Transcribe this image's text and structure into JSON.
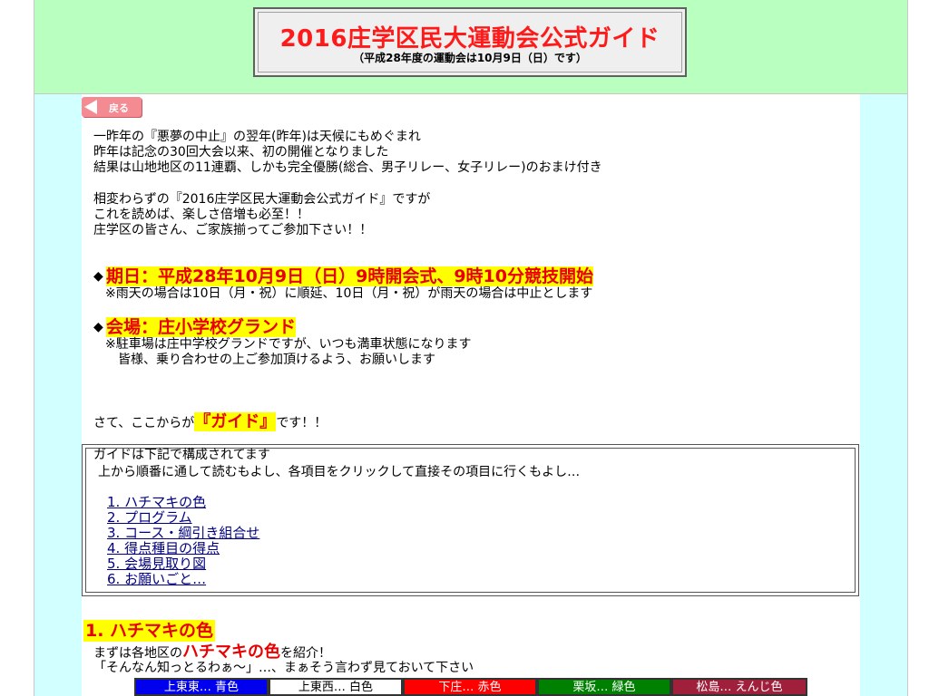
{
  "header": {
    "title": "2016庄学区民大運動会公式ガイド",
    "subtitle": "（平成28年度の運動会は10月9日（日）です）"
  },
  "back_button": {
    "label": "戻る"
  },
  "intro": [
    "一昨年の『悪夢の中止』の翌年(昨年)は天候にもめぐまれ",
    "昨年は記念の30回大会以来、初の開催となりました",
    "結果は山地地区の11連覇、しかも完全優勝(総合、男子リレー、女子リレー)のおまけ付き",
    "相変わらずの『2016庄学区民大運動会公式ガイド』ですが",
    "これを読めば、楽しさ倍増も必至！！",
    "庄学区の皆さん、ご家族揃ってご参加下さい！！"
  ],
  "date": {
    "bullet": "◆",
    "headline": "期日：平成28年10月9日（日）9時開会式、9時10分競技開始",
    "note": "※雨天の場合は10日（月・祝）に順延、10日（月・祝）が雨天の場合は中止とします"
  },
  "venue": {
    "bullet": "◆",
    "headline": "会場：庄小学校グランド",
    "note1": "※駐車場は庄中学校グランドですが、いつも満車状態になります",
    "note2": "皆様、乗り合わせの上ご参加頂けるよう、お願いします"
  },
  "guide_lead": {
    "before": "さて、ここからが",
    "highlight": "『ガイド』",
    "after": "です！！"
  },
  "guide_box": {
    "line1": "ガイドは下記で構成されてます",
    "line2": "上から順番に通して読むもよし、各項目をクリックして直接その項目に行くもよし…",
    "toc": [
      "1. ハチマキの色",
      "2. プログラム",
      "3. コース・綱引き組合せ",
      "4. 得点種目の得点",
      "5. 会場見取り図",
      "6. お願いごと…"
    ]
  },
  "section1": {
    "heading": "1. ハチマキの色",
    "line1_before": "まずは各地区の",
    "line1_highlight": "ハチマキの色",
    "line1_after": "を紹介！",
    "line2": "「そんなん知っとるわぁ～」…、まぁそう言わず見ておいて下さい"
  },
  "colors": [
    {
      "label": "上東東… 青色",
      "bg": "#0000ee",
      "fg": "#ffffff"
    },
    {
      "label": "上東西… 白色",
      "bg": "#ffffff",
      "fg": "#000000"
    },
    {
      "label": "下庄… 赤色",
      "bg": "#ff0000",
      "fg": "#ffffff"
    },
    {
      "label": "栗坂… 緑色",
      "bg": "#008000",
      "fg": "#ffffff"
    },
    {
      "label": "松島… えんじ色",
      "bg": "#a0203c",
      "fg": "#ffffff"
    }
  ]
}
